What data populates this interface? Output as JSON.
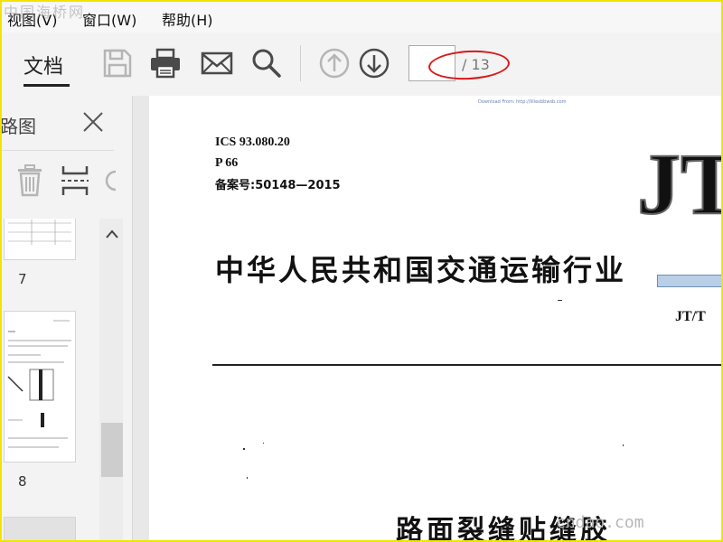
{
  "watermarks": {
    "top": "中国海桥网",
    "bottom": "cndao.com"
  },
  "menu": {
    "view": "视图(V)",
    "window": "窗口(W)",
    "help": "帮助(H)"
  },
  "toolbar": {
    "doc_tab": "文档",
    "page_input": "",
    "page_total": "/ 13"
  },
  "sidebar": {
    "title": "路图",
    "thumbnails": [
      {
        "num": "7"
      },
      {
        "num": "8"
      }
    ]
  },
  "document": {
    "download_note": "Download From: http://Iillexbbwsb.com",
    "ics": "ICS 93.080.20",
    "p": "P 66",
    "record": "备案号:50148—2015",
    "logo": "JT",
    "title": "中华人民共和国交通运输行业",
    "code": "JT/T",
    "subtitle": "路面裂缝贴缝胶"
  },
  "colors": {
    "accent_red": "#d81b1b",
    "disabled_icon": "#b5b5b5",
    "active_icon": "#4a4a4a"
  }
}
